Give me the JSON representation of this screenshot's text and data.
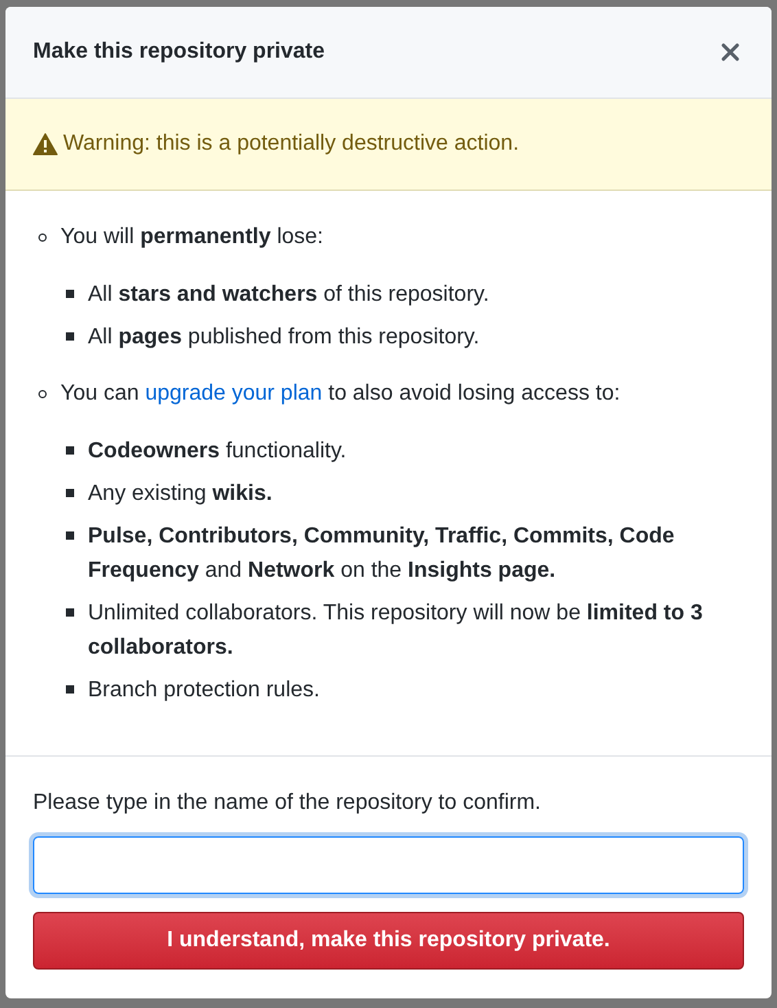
{
  "dialog": {
    "title": "Make this repository private",
    "warning": "Warning: this is a potentially destructive action.",
    "sections": [
      {
        "text": "You will **permanently** lose:",
        "items": [
          "All **stars and watchers** of this repository.",
          "All **pages** published from this repository."
        ]
      },
      {
        "text_before": "You can",
        "link": "upgrade your plan",
        "text_after": "to also avoid losing access to:",
        "items": [
          "**Codeowners** functionality.",
          "Any existing **wikis.**",
          "**Pulse, Contributors, Community, Traffic, Commits, Code Frequency** and **Network** on the **Insights page.**",
          "Unlimited collaborators. This repository will now be **limited to 3 collaborators.**",
          "Branch protection rules."
        ]
      }
    ],
    "confirm_prompt": "Please type in the name of the repository to confirm.",
    "confirm_button": "I understand, make this repository private."
  }
}
